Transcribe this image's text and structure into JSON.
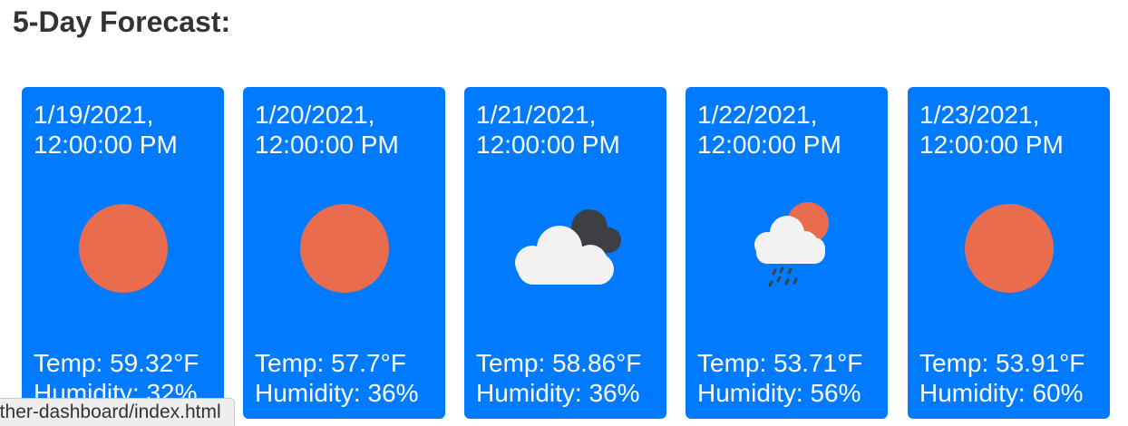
{
  "heading": "5-Day Forecast:",
  "card_color": "#007bff",
  "status_bar": {
    "text": "ather-dashboard/index.html"
  },
  "forecast": [
    {
      "date": "1/19/2021,",
      "time": "12:00:00 PM",
      "icon": "sun-icon",
      "temp": "Temp: 59.32°F",
      "humidity": "Humidity: 32%"
    },
    {
      "date": "1/20/2021,",
      "time": "12:00:00 PM",
      "icon": "sun-icon",
      "temp": "Temp: 57.7°F",
      "humidity": "Humidity: 36%"
    },
    {
      "date": "1/21/2021,",
      "time": "12:00:00 PM",
      "icon": "broken-clouds-icon",
      "temp": "Temp: 58.86°F",
      "humidity": "Humidity: 36%"
    },
    {
      "date": "1/22/2021,",
      "time": "12:00:00 PM",
      "icon": "rain-sun-cloud-icon",
      "temp": "Temp: 53.71°F",
      "humidity": "Humidity: 56%"
    },
    {
      "date": "1/23/2021,",
      "time": "12:00:00 PM",
      "icon": "sun-icon",
      "temp": "Temp: 53.91°F",
      "humidity": "Humidity: 60%"
    }
  ]
}
